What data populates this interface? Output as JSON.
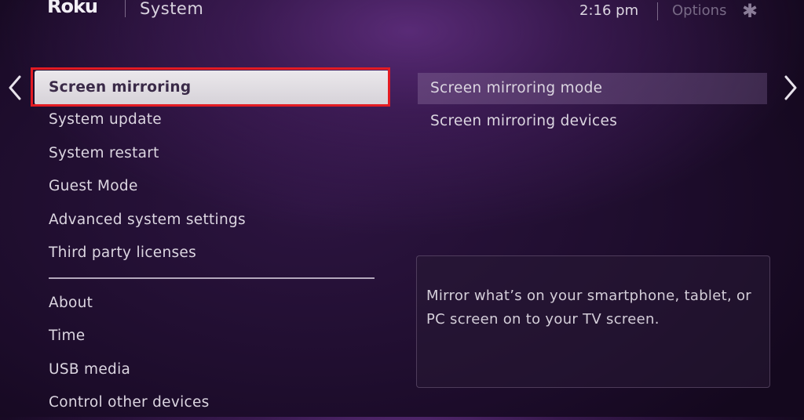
{
  "header": {
    "logo": "Roku",
    "section_title": "System",
    "clock": "2:16  pm",
    "options_label": "Options",
    "options_icon": "asterisk-icon"
  },
  "navigation": {
    "back_icon": "chevron-left-icon",
    "forward_icon": "chevron-right-icon"
  },
  "menu": {
    "selected_index": 0,
    "items": [
      {
        "label": "Screen mirroring"
      },
      {
        "label": "System update"
      },
      {
        "label": "System restart"
      },
      {
        "label": "Guest Mode"
      },
      {
        "label": "Advanced system settings"
      },
      {
        "label": "Third party licenses"
      }
    ],
    "secondary_items": [
      {
        "label": "About"
      },
      {
        "label": "Time"
      },
      {
        "label": "USB media"
      },
      {
        "label": "Control other devices"
      }
    ]
  },
  "submenu": {
    "items": [
      {
        "label": "Screen mirroring mode"
      },
      {
        "label": "Screen mirroring devices"
      }
    ]
  },
  "description": "Mirror what’s on your smartphone, tablet, or PC screen on to your TV screen.",
  "colors": {
    "focus_outline": "#e31b23",
    "background_purple": "#4a2270"
  }
}
